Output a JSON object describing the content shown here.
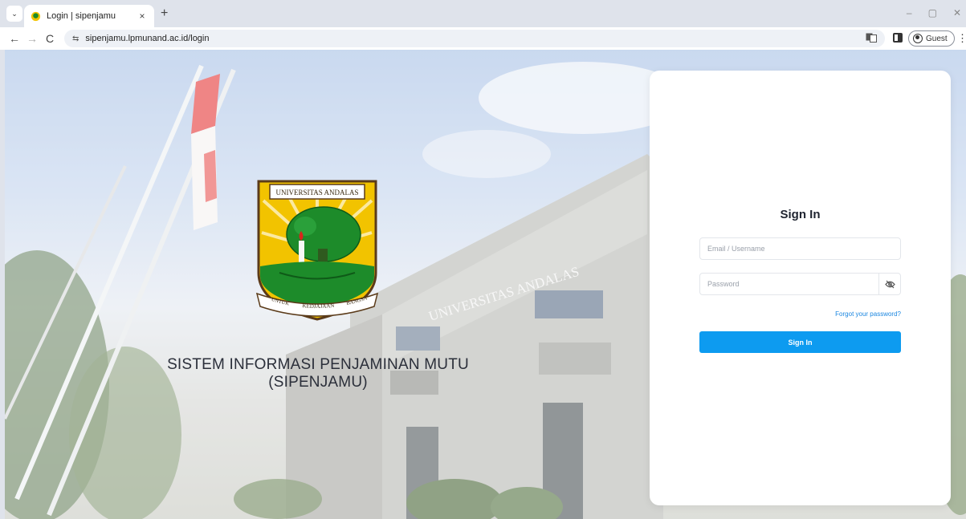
{
  "browser": {
    "tab_title": "Login | sipenjamu",
    "tab_close": "×",
    "new_tab": "+",
    "url": "sipenjamu.lpmunand.ac.id/login",
    "profile_label": "Guest",
    "back_icon": "arrow-left-icon",
    "forward_icon": "arrow-right-icon",
    "reload_icon": "reload-icon",
    "win_min": "–",
    "win_max": "▢",
    "win_close": "✕",
    "back_glyph": "←",
    "forward_glyph": "→",
    "reload_glyph": "C",
    "site_info_glyph": "⇆",
    "more_glyph": "⋮"
  },
  "page": {
    "logo_top_text": "UNIVERSITAS ANDALAS",
    "logo_ribbon_left": "UNTUK",
    "logo_ribbon_mid": "KEDJAJAAN",
    "logo_ribbon_right": "BANGSA",
    "building_sign": "UNIVERSITAS ANDALAS",
    "app_title_line1": "SISTEM INFORMASI PENJAMINAN MUTU",
    "app_title_line2": "(SIPENJAMU)"
  },
  "login": {
    "title": "Sign In",
    "email_placeholder": "Email / Username",
    "email_value": "",
    "password_placeholder": "Password",
    "password_value": "",
    "forgot_label": "Forgot your password?",
    "submit_label": "Sign In"
  },
  "colors": {
    "primary": "#0d9bf0",
    "link": "#1a86e0",
    "logo_yellow": "#f2c300",
    "logo_green": "#1d8b2a"
  }
}
